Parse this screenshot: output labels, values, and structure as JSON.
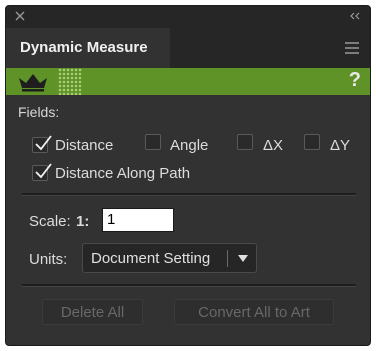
{
  "panel": {
    "title": "Dynamic Measure",
    "help": "?"
  },
  "fields": {
    "label": "Fields:",
    "distance": {
      "label": "Distance",
      "checked": true
    },
    "angle": {
      "label": "Angle",
      "checked": false
    },
    "dx": {
      "label": "ΔX",
      "checked": false
    },
    "dy": {
      "label": "ΔY",
      "checked": false
    },
    "along_path": {
      "label": "Distance Along Path",
      "checked": true
    }
  },
  "scale": {
    "label": "Scale:",
    "prefix": "1:",
    "value": "1"
  },
  "units": {
    "label": "Units:",
    "selected": "Document Setting"
  },
  "buttons": {
    "delete_all": "Delete All",
    "convert_all": "Convert All to Art"
  },
  "colors": {
    "banner": "#5f9327",
    "panel_bg": "#323232"
  }
}
